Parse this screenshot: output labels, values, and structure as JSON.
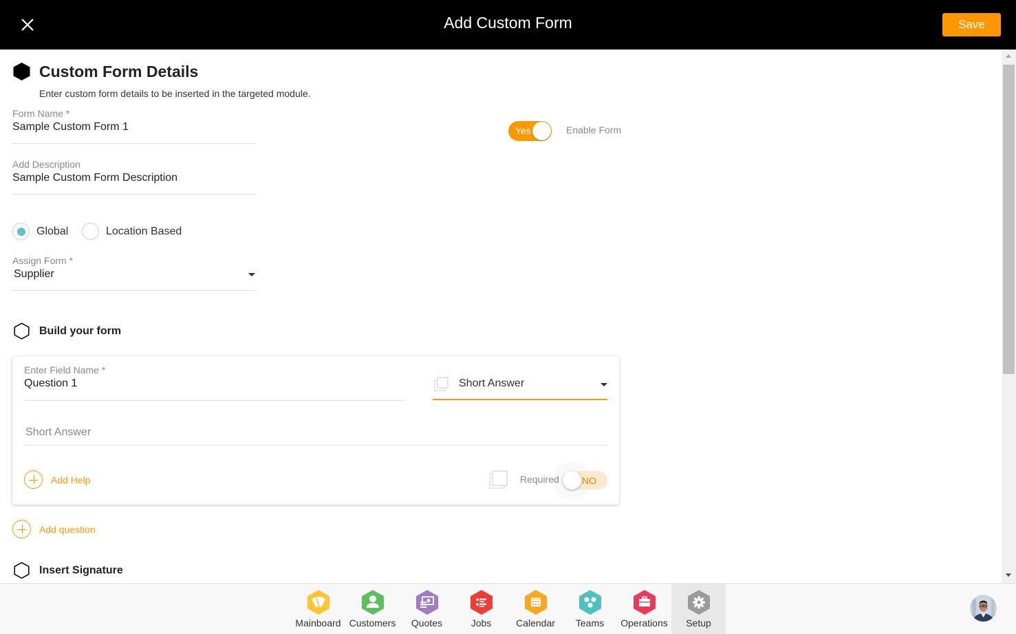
{
  "header": {
    "title": "Add Custom Form",
    "save_label": "Save",
    "close_icon": "close-icon"
  },
  "details": {
    "title": "Custom Form Details",
    "subtitle": "Enter custom form details to be inserted in the targeted module.",
    "form_name": {
      "label": "Form Name *",
      "value": "Sample Custom Form 1"
    },
    "description": {
      "label": "Add Description",
      "value": "Sample Custom Form Description"
    },
    "enable_toggle": {
      "state_label": "Yes",
      "label": "Enable Form",
      "on": true
    },
    "scope": {
      "options": [
        {
          "label": "Global",
          "selected": true
        },
        {
          "label": "Location Based",
          "selected": false
        }
      ]
    },
    "assign_form": {
      "label": "Assign Form *",
      "value": "Supplier"
    }
  },
  "builder": {
    "title": "Build your form",
    "question": {
      "field_name_label": "Enter Field Name *",
      "field_name_value": "Question 1",
      "type_value": "Short Answer",
      "answer_placeholder": "Short Answer",
      "add_help_label": "Add Help",
      "required_label": "Required",
      "required_toggle_label": "NO",
      "required": false
    },
    "add_question_label": "Add question"
  },
  "signature": {
    "title": "Insert Signature"
  },
  "bottom_nav": {
    "items": [
      {
        "label": "Mainboard",
        "icon": "mainboard-icon",
        "color": "#fdc534",
        "active": false
      },
      {
        "label": "Customers",
        "icon": "customer-icon",
        "color": "#5cbf5f",
        "active": false
      },
      {
        "label": "Quotes",
        "icon": "quotes-icon",
        "color": "#a07cc4",
        "active": false
      },
      {
        "label": "Jobs",
        "icon": "jobs-list-icon",
        "color": "#ec3e38",
        "active": false
      },
      {
        "label": "Calendar",
        "icon": "calendar-icon",
        "color": "#f6a821",
        "active": false
      },
      {
        "label": "Teams",
        "icon": "teams-icon",
        "color": "#4fc1c1",
        "active": false
      },
      {
        "label": "Operations",
        "icon": "briefcase-icon",
        "color": "#e83a5a",
        "active": false
      },
      {
        "label": "Setup",
        "icon": "gear-icon",
        "color": "#9b9b9b",
        "active": true
      }
    ]
  },
  "colors": {
    "accent": "#ff9800",
    "radio_selected": "#5bc4c4",
    "topbar": "#000000"
  }
}
